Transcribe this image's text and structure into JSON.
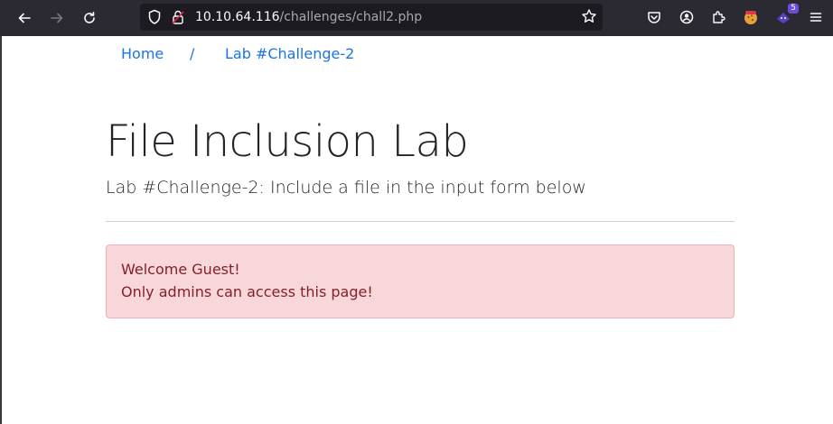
{
  "browser": {
    "url_host": "10.10.64.116",
    "url_path": "/challenges/chall2.php",
    "extension_badge": "5"
  },
  "breadcrumb": {
    "home": "Home",
    "separator": "/",
    "current": "Lab #Challenge-2"
  },
  "main": {
    "title": "File Inclusion Lab",
    "subtitle": "Lab #Challenge-2: Include a file in the input form below"
  },
  "alert": {
    "line1": "Welcome Guest!",
    "line2": "Only admins can access this page!"
  },
  "colors": {
    "toolbar_bg": "#2b2a33",
    "link": "#1a73e8",
    "alert_bg": "#f8d7da",
    "alert_text": "#842029"
  }
}
